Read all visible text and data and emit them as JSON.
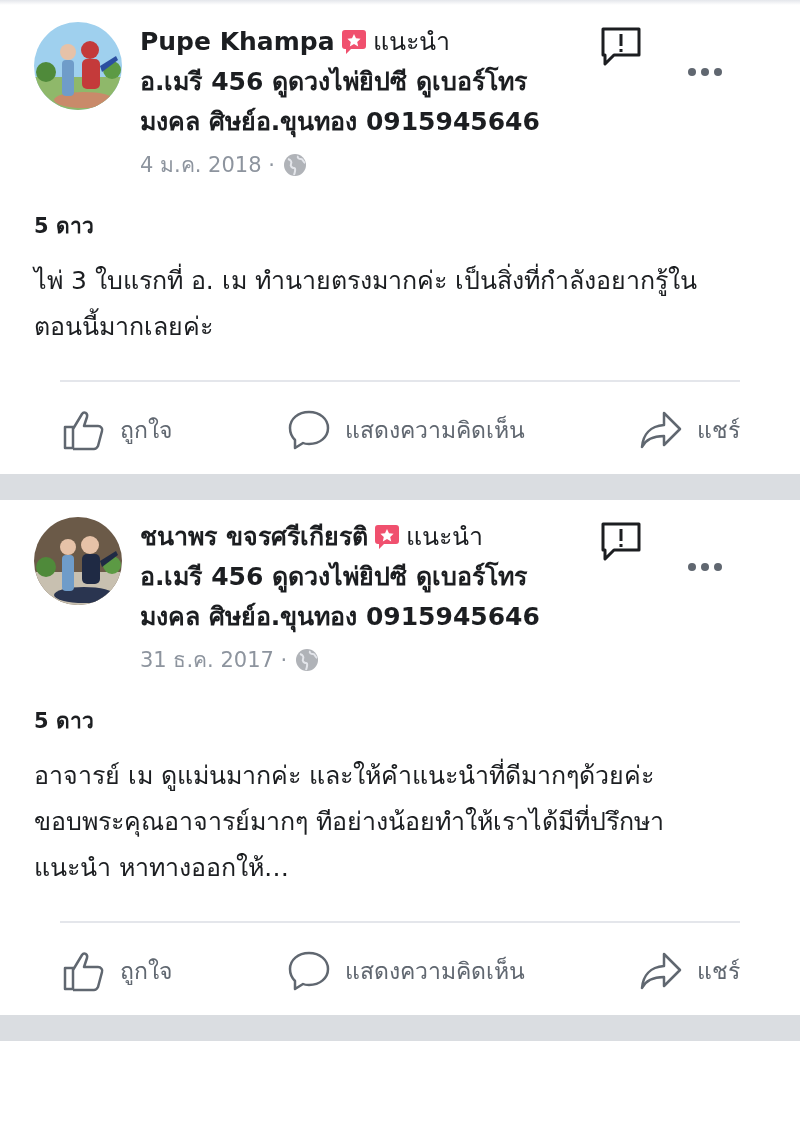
{
  "posts": [
    {
      "author": "Pupe Khampa",
      "recommend": "แนะนำ",
      "page": "อ.เมรี 456 ดูดวงไพ่ยิปซี ดูเบอร์โทรมงคล ศิษย์อ.ขุนทอง 0915945646",
      "date": "4 ม.ค. 2018 ·",
      "rating": "5 ดาว",
      "text": "ไพ่ 3 ใบแรกที่ อ. เม ทำนายตรงมากค่ะ เป็นสิ่งที่กำลังอยากรู้ในตอนนี้มากเลยค่ะ",
      "actions": [
        {
          "kind": "like",
          "label": "ถูกใจ"
        },
        {
          "kind": "comment",
          "label": "แสดงความคิดเห็น"
        },
        {
          "kind": "share",
          "label": "แชร์"
        }
      ]
    },
    {
      "author": "ชนาพร ขจรศรีเกียรติ",
      "recommend": "แนะนำ",
      "page": "อ.เมรี 456 ดูดวงไพ่ยิปซี ดูเบอร์โทรมงคล ศิษย์อ.ขุนทอง 0915945646",
      "date": "31 ธ.ค. 2017 ·",
      "rating": "5 ดาว",
      "text": "อาจารย์ เม ดูแม่นมากค่ะ และให้คำแนะนำที่ดีมากๆด้วยค่ะ ขอบพระคุณอาจารย์มากๆ ทีอย่างน้อยทำให้เราได้มีที่ปรึกษาแนะนำ หาทางออกให้…",
      "actions": [
        {
          "kind": "like",
          "label": "ถูกใจ"
        },
        {
          "kind": "comment",
          "label": "แสดงความคิดเห็น"
        },
        {
          "kind": "share",
          "label": "แชร์"
        }
      ]
    }
  ]
}
